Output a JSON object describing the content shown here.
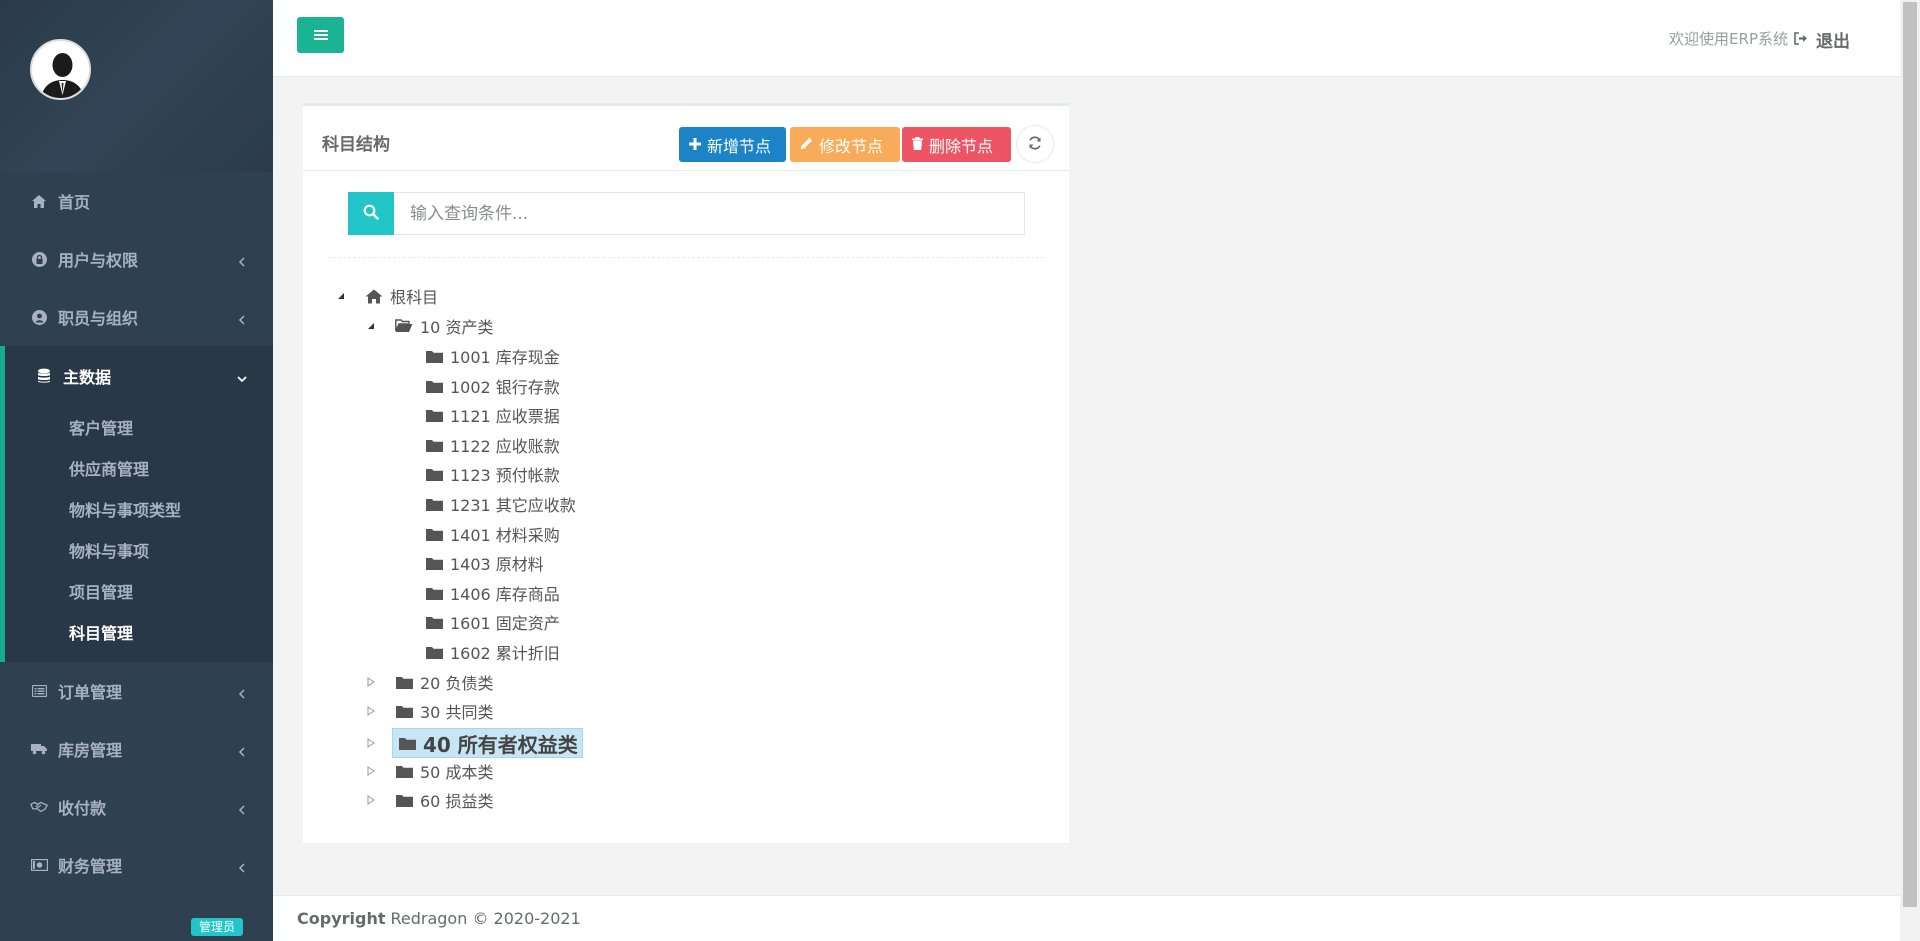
{
  "sidebar": {
    "role_badge": "管理员",
    "items": [
      {
        "label": "首页",
        "icon": "home-icon"
      },
      {
        "label": "用户与权限",
        "icon": "lock-icon"
      },
      {
        "label": "职员与组织",
        "icon": "user-circle-icon"
      },
      {
        "label": "主数据",
        "icon": "database-icon",
        "expanded": true
      },
      {
        "label": "订单管理",
        "icon": "list-alt-icon"
      },
      {
        "label": "库房管理",
        "icon": "truck-icon"
      },
      {
        "label": "收付款",
        "icon": "handshake-icon"
      },
      {
        "label": "财务管理",
        "icon": "money-icon"
      }
    ],
    "submenu": [
      {
        "label": "客户管理"
      },
      {
        "label": "供应商管理"
      },
      {
        "label": "物料与事项类型"
      },
      {
        "label": "物料与事项"
      },
      {
        "label": "项目管理"
      },
      {
        "label": "科目管理",
        "current": true
      }
    ]
  },
  "topbar": {
    "welcome": "欢迎使用ERP系统",
    "logout": "退出"
  },
  "panel": {
    "title": "科目结构",
    "buttons": {
      "add": "新增节点",
      "edit": "修改节点",
      "delete": "删除节点"
    },
    "search_placeholder": "输入查询条件..."
  },
  "tree": {
    "root": "根科目",
    "nodes": [
      {
        "label": "10 资产类",
        "level": 1,
        "expanded": true
      },
      {
        "label": "1001 库存现金",
        "level": 2
      },
      {
        "label": "1002 银行存款",
        "level": 2
      },
      {
        "label": "1121 应收票据",
        "level": 2
      },
      {
        "label": "1122 应收账款",
        "level": 2
      },
      {
        "label": "1123 预付帐款",
        "level": 2
      },
      {
        "label": "1231 其它应收款",
        "level": 2
      },
      {
        "label": "1401 材料采购",
        "level": 2
      },
      {
        "label": "1403 原材料",
        "level": 2
      },
      {
        "label": "1406 库存商品",
        "level": 2
      },
      {
        "label": "1601 固定资产",
        "level": 2
      },
      {
        "label": "1602 累计折旧",
        "level": 2
      },
      {
        "label": "20 负债类",
        "level": 1
      },
      {
        "label": "30 共同类",
        "level": 1
      },
      {
        "label": "40 所有者权益类",
        "level": 1,
        "selected": true
      },
      {
        "label": "50 成本类",
        "level": 1
      },
      {
        "label": "60 损益类",
        "level": 1
      }
    ]
  },
  "footer": {
    "copyright_label": "Copyright",
    "copyright_text": "Redragon © 2020-2021"
  },
  "colors": {
    "sidebar_bg": "#2f4050",
    "primary": "#1ab394",
    "add": "#1c84c6",
    "edit": "#f8ac59",
    "delete": "#ed5565",
    "search": "#23c6c8",
    "selected_bg": "#c6e6f5"
  }
}
